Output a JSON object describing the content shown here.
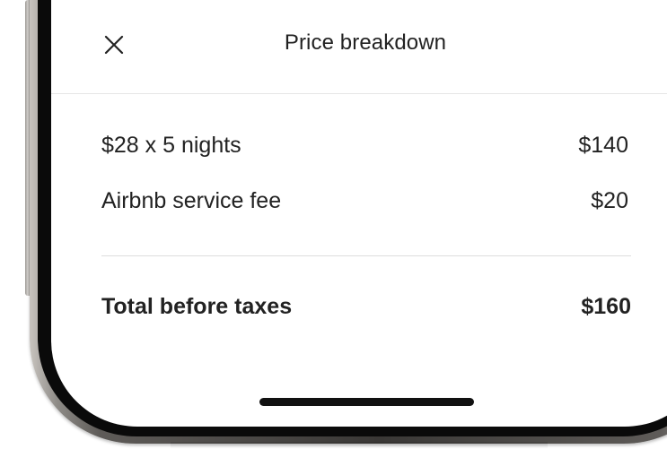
{
  "modal": {
    "title": "Price breakdown",
    "close_icon": "close-icon"
  },
  "price_lines": [
    {
      "label": "$28 x 5 nights",
      "amount": "$140"
    },
    {
      "label": "Airbnb service fee",
      "amount": "$20"
    }
  ],
  "total": {
    "label": "Total before taxes",
    "amount": "$160"
  },
  "colors": {
    "text": "#222222",
    "divider": "#dddddd",
    "background": "#ffffff"
  }
}
